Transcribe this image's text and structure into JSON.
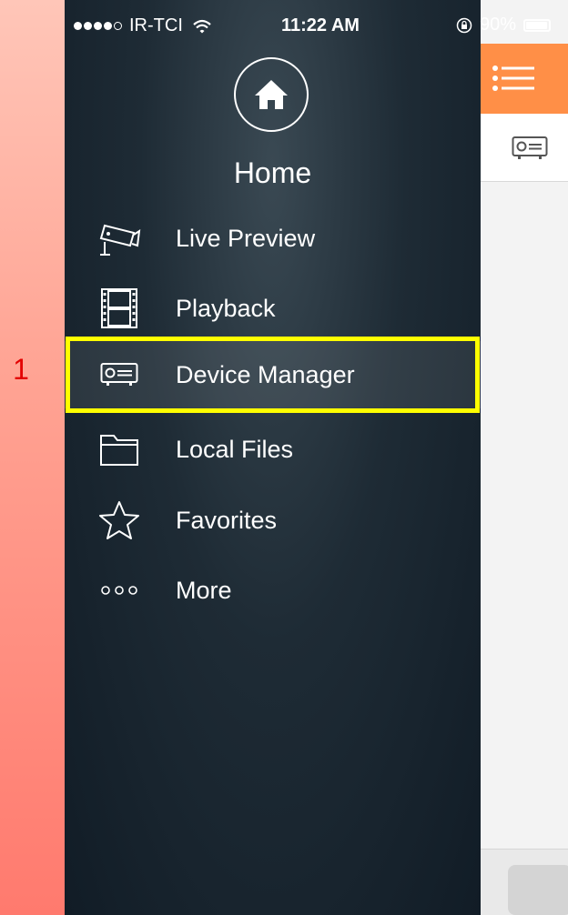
{
  "annotation": {
    "step_number": "1",
    "highlight_color": "#ffff00"
  },
  "status_bar": {
    "carrier": "IR-TCI",
    "time": "11:22 AM",
    "battery": "90%"
  },
  "drawer": {
    "title": "Home",
    "items": [
      {
        "label": "Live Preview",
        "icon": "cctv-camera-icon"
      },
      {
        "label": "Playback",
        "icon": "film-strip-icon"
      },
      {
        "label": "Device Manager",
        "icon": "dvr-device-icon",
        "selected": true
      },
      {
        "label": "Local Files",
        "icon": "folder-icon"
      },
      {
        "label": "Favorites",
        "icon": "star-icon"
      },
      {
        "label": "More",
        "icon": "more-dots-icon"
      }
    ]
  },
  "colors": {
    "accent_orange": "#ff8f47",
    "drawer_dark": "#1e2b35",
    "annotation_red": "#e30000"
  }
}
